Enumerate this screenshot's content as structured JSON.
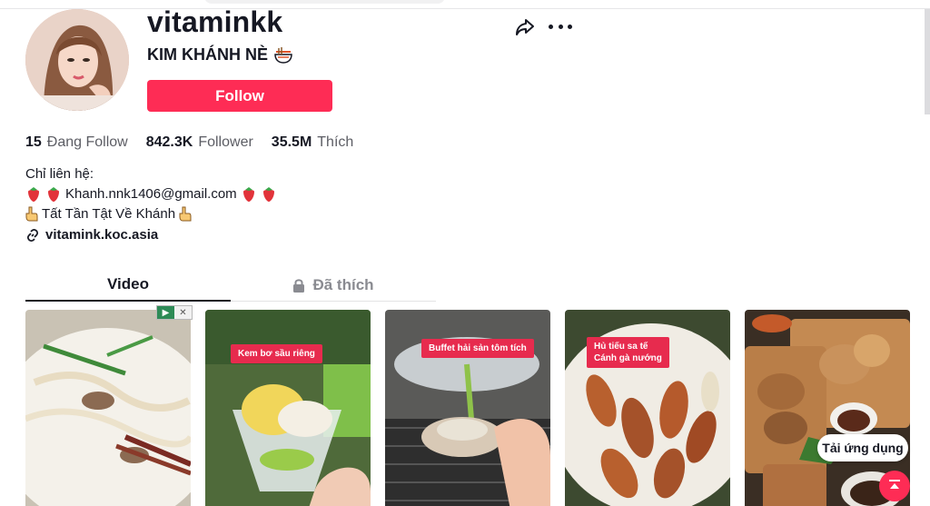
{
  "profile": {
    "username": "vitaminkk",
    "nickname": "KIM KHÁNH NÈ",
    "follow_label": "Follow"
  },
  "stats": {
    "following_count": "15",
    "following_label": "Đang Follow",
    "followers_count": "842.3K",
    "followers_label": "Follower",
    "likes_count": "35.5M",
    "likes_label": "Thích"
  },
  "bio": {
    "line1": "Chỉ liên hệ:",
    "email": "Khanh.nnk1406@gmail.com",
    "line3": "Tất Tần Tật Về Khánh",
    "link": "vitamink.koc.asia"
  },
  "tabs": [
    {
      "label": "Video"
    },
    {
      "label": "Đã thích"
    }
  ],
  "videos": [
    {
      "caption": ""
    },
    {
      "caption": "Kem bơ sầu riêng"
    },
    {
      "caption": "Buffet hải sản tôm tích"
    },
    {
      "caption_line1": "Hủ tiếu sa tế",
      "caption_line2": "Cánh gà nướng"
    },
    {
      "caption": ""
    }
  ],
  "floating": {
    "app_label": "Tải ứng dụng"
  },
  "colors": {
    "accent": "#fe2c55",
    "tag": "#e72b4e"
  },
  "icons": [
    "share-icon",
    "more-icon",
    "link-icon",
    "lock-icon",
    "strawberry-icon",
    "pointing-hand-icon",
    "noodle-bowl-icon",
    "back-to-top-icon"
  ]
}
